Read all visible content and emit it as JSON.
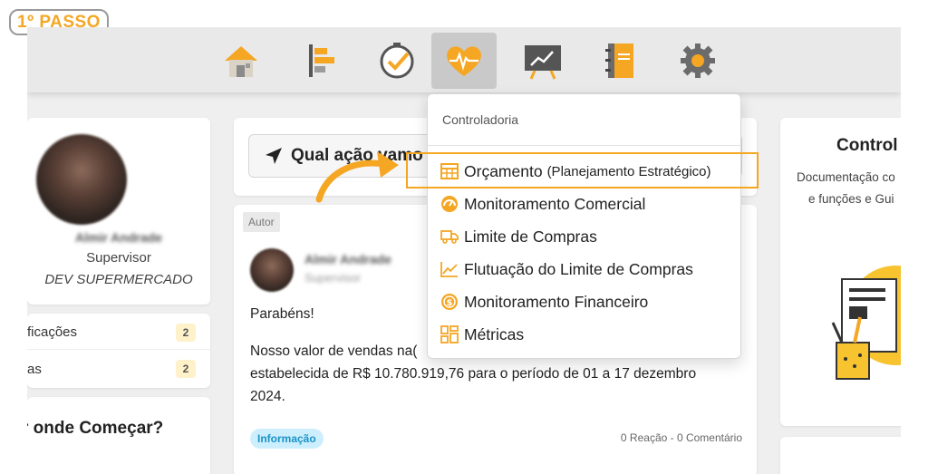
{
  "step_badge": "1º PASSO",
  "nav": {
    "items": [
      {
        "name": "home-icon",
        "active": false
      },
      {
        "name": "timeline-icon",
        "active": false
      },
      {
        "name": "clock-check-icon",
        "active": false
      },
      {
        "name": "heart-pulse-icon",
        "active": true
      },
      {
        "name": "presentation-chart-icon",
        "active": false
      },
      {
        "name": "notebook-icon",
        "active": false
      },
      {
        "name": "gear-icon",
        "active": false
      }
    ]
  },
  "profile": {
    "name": "Almir Andrade",
    "role": "Supervisor",
    "company": "DEV SUPERMERCADO"
  },
  "notifications": {
    "items": [
      {
        "label": "ficações",
        "count": "2"
      },
      {
        "label": "as",
        "count": "2"
      }
    ]
  },
  "start_heading": "r onde Começar?",
  "action_prompt": "Qual ação vamo",
  "post": {
    "author_tag": "Autor",
    "author_name": "Almir Andrade",
    "author_role": "Supervisor",
    "greeting": "Parabéns!",
    "line1": "Nosso valor de vendas na(",
    "line2": "estabelecida de R$ 10.780.919,76 para o período de 01 a 17 dezembro",
    "line3": "2024.",
    "tag": "Informação",
    "reactions": "0 Reação - 0 Comentário"
  },
  "right_panel": {
    "title": "Control",
    "desc_line1": "Documentação co",
    "desc_line2": "e funções e Gui"
  },
  "dropdown": {
    "header": "Controladoria",
    "items": [
      {
        "label": "Orçamento",
        "sub": "(Planejamento Estratégico)",
        "icon": "table-icon"
      },
      {
        "label": "Monitoramento Comercial",
        "icon": "gauge-icon"
      },
      {
        "label": "Limite de Compras",
        "icon": "truck-icon"
      },
      {
        "label": "Flutuação do Limite de Compras",
        "icon": "line-chart-icon"
      },
      {
        "label": "Monitoramento Financeiro",
        "icon": "dollar-coin-icon"
      },
      {
        "label": "Métricas",
        "icon": "grid-icon"
      }
    ]
  },
  "colors": {
    "accent": "#f5a623",
    "nav_bg": "#e9e9e9",
    "info_pill": "#cdeefd"
  }
}
